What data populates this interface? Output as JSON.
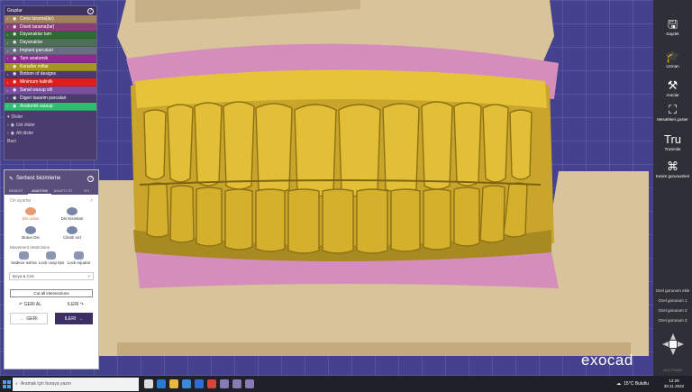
{
  "groups_panel": {
    "title": "Gruplar",
    "help": "?",
    "items": [
      {
        "label": "Ceria tarama(lar)",
        "color": "#a0835e"
      },
      {
        "label": "Diseti tarama(lar)",
        "color": "#8a3e7a"
      },
      {
        "label": "Dayanaklar tam",
        "color": "#2f6a34"
      },
      {
        "label": "Dayanaklar",
        "color": "#4e6e57"
      },
      {
        "label": "Implant parcalari",
        "color": "#6a6e82"
      },
      {
        "label": "Tam anatomik",
        "color": "#8e2b8f"
      },
      {
        "label": "Kanallar mitlar",
        "color": "#a6961f"
      },
      {
        "label": "Bottom of designs",
        "color": "#4a3d6e"
      },
      {
        "label": "Minimum kalinlik",
        "color": "#e21c1c"
      },
      {
        "label": "Sanal waxup stil",
        "color": "#7a4fa0"
      },
      {
        "label": "Digeri tasarim parcalari",
        "color": "#4a3d6e"
      },
      {
        "label": "Anatomik waxup",
        "color": "#2dbd73"
      }
    ],
    "subsections": {
      "title": "Disler",
      "upper": "Ust disler",
      "lower": "Alt disler",
      "footer": "Bazi"
    }
  },
  "tool_panel": {
    "title": "Serbest bicimleme",
    "help": "?",
    "tabs": [
      "BEBEDT",
      "ANATOMI",
      "ANAPTI ST",
      "ATI"
    ],
    "active_tab": "ANATOMI",
    "on_ayarlar": "On ayarlar",
    "presets": [
      {
        "label": "Dis ucları",
        "active": true
      },
      {
        "label": "Dis Kisimlari",
        "active": false
      },
      {
        "label": "Butun Dis",
        "active": false
      },
      {
        "label": "Cikinti sırt",
        "active": false
      }
    ],
    "movement_title": "Movement restrictions",
    "movements": [
      {
        "label": "Sadece isirma"
      },
      {
        "label": "Lock cusp tips"
      },
      {
        "label": "Lock equator"
      }
    ],
    "paint": "Boya & Cek",
    "cut_all": "Cut all intersections",
    "undo": "GERI AL",
    "redo": "ILERI",
    "back": "GERI",
    "next": "ILERI"
  },
  "right_bar": {
    "tools": [
      {
        "label": "Kaydet",
        "icon": "save-icon",
        "glyph": "🖫"
      },
      {
        "label": "Uzman",
        "icon": "mortarboard-icon",
        "glyph": "🎓"
      },
      {
        "label": "Araclar",
        "icon": "tools-icon",
        "glyph": "⚒"
      },
      {
        "label": "Mesafeleri goster",
        "icon": "distance-icon",
        "glyph": "⛶"
      },
      {
        "label": "TruSmile",
        "icon": "trusmile-icon",
        "glyph": "Tru"
      },
      {
        "label": "Kesim gorunumleri",
        "icon": "tooth-icon",
        "glyph": "⌘"
      }
    ],
    "views": [
      "Ozel gorunum ekle",
      "Ozel gorunum 1",
      "Ozel gorunum 2",
      "Ozel gorunum 3"
    ],
    "version": "v3.0-7734/64"
  },
  "branding": {
    "logo": "exocad"
  },
  "taskbar": {
    "search_placeholder": "Aramak için buraya yazın",
    "weather": "15°C Bulutlu",
    "time": "12:29",
    "date": "30.11.2022"
  }
}
